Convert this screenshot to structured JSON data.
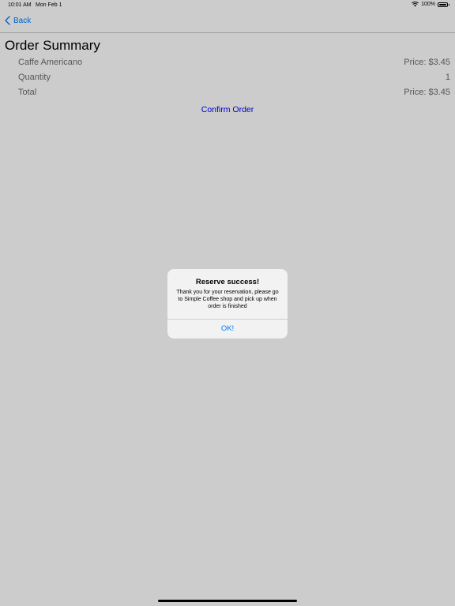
{
  "status_bar": {
    "time": "10:01 AM",
    "date": "Mon Feb 1",
    "battery": "100%"
  },
  "nav": {
    "back_label": "Back"
  },
  "summary": {
    "title": "Order Summary",
    "item_name": "Caffe Americano",
    "item_price": "Price: $3.45",
    "quantity_label": "Quantity",
    "quantity_value": "1",
    "total_label": "Total",
    "total_value": "Price: $3.45",
    "confirm_label": "Confirm Order"
  },
  "alert": {
    "title": "Reserve success!",
    "message": "Thank you for your reservation, please go to Simple Coffee shop and pick up when order is finished",
    "ok_label": "OK!"
  },
  "colors": {
    "accent": "#007aff",
    "confirm_link": "#0000ff",
    "secondary_text": "#6d6d72",
    "alert_background": "#f2f2f2"
  },
  "icons": {
    "back": "chevron-left-icon",
    "wifi": "wifi-icon",
    "battery": "battery-icon"
  }
}
